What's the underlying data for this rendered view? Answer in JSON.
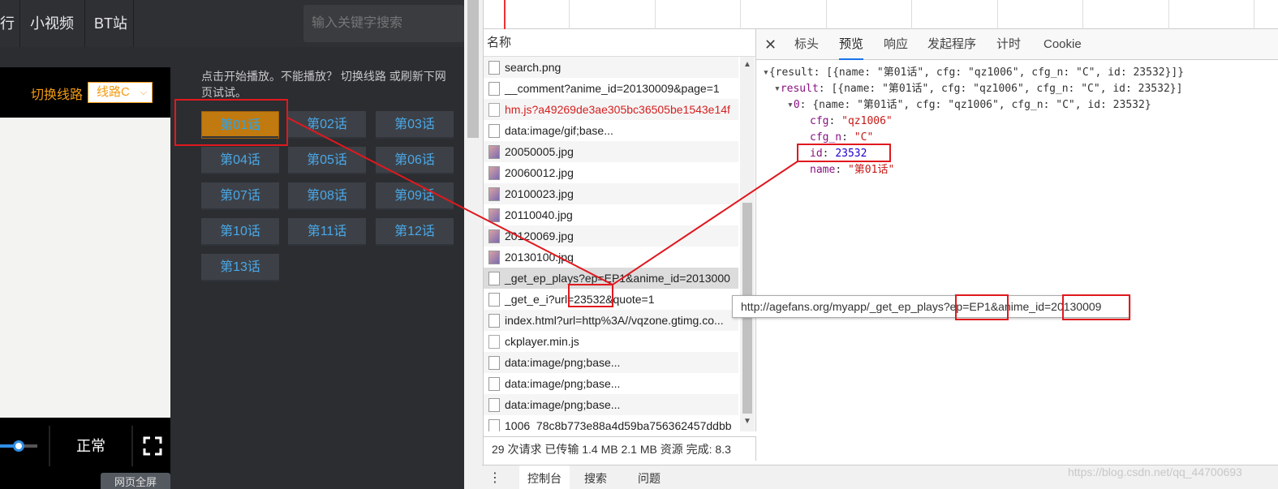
{
  "site": {
    "nav": [
      {
        "label": "行"
      },
      {
        "label": "小视频"
      },
      {
        "label": "BT站"
      }
    ],
    "search_placeholder": "输入关键字搜索",
    "player": {
      "switch_label": "切换线路",
      "line_value": "线路C",
      "speed_label": "正常",
      "volume_level": 0.5
    },
    "hint_text": "点击开始播放。不能播放？ 切换线路 或刷新下网页试试。",
    "episodes": [
      "第01话",
      "第02话",
      "第03话",
      "第04话",
      "第05话",
      "第06话",
      "第07话",
      "第08话",
      "第09话",
      "第10话",
      "第11话",
      "第12话",
      "第13话"
    ],
    "active_episode": "第01话",
    "page_list_btn": "网页全屏"
  },
  "devtools": {
    "name_header": "名称",
    "requests": [
      {
        "name": "search.png",
        "type": "img"
      },
      {
        "name": "__comment?anime_id=20130009&page=1",
        "type": "doc"
      },
      {
        "name": "hm.js?a49269de3ae305bc36505be1543e14f",
        "type": "js",
        "error": true
      },
      {
        "name": "data:image/gif;base...",
        "type": "doc"
      },
      {
        "name": "20050005.jpg",
        "type": "img"
      },
      {
        "name": "20060012.jpg",
        "type": "img"
      },
      {
        "name": "20100023.jpg",
        "type": "img"
      },
      {
        "name": "20110040.jpg",
        "type": "img"
      },
      {
        "name": "20120069.jpg",
        "type": "img"
      },
      {
        "name": "20130100.jpg",
        "type": "img"
      },
      {
        "name": "_get_ep_plays?ep=EP1&anime_id=2013000",
        "type": "doc",
        "selected": true
      },
      {
        "name": "_get_e_i?url=23532&quote=1",
        "type": "doc"
      },
      {
        "name": "index.html?url=http%3A//vqzone.gtimg.co...",
        "type": "doc"
      },
      {
        "name": "ckplayer.min.js",
        "type": "js"
      },
      {
        "name": "data:image/png;base...",
        "type": "img"
      },
      {
        "name": "data:image/png;base...",
        "type": "img"
      },
      {
        "name": "data:image/png;base...",
        "type": "doc"
      },
      {
        "name": "1006_78c8b773e88a4d59ba756362457ddbb",
        "type": "doc"
      }
    ],
    "status_text": "29 次请求  已传输 1.4 MB  2.1 MB 资源  完成: 8.3",
    "tabs": [
      "标头",
      "预览",
      "响应",
      "发起程序",
      "计时",
      "Cookie"
    ],
    "active_tab": "预览",
    "preview": {
      "line1": "{result: [{name: \"第01话\", cfg: \"qz1006\", cfg_n: \"C\", id: 23532}]}",
      "line2_key": "result",
      "line2_val": "[{name: \"第01话\", cfg: \"qz1006\", cfg_n: \"C\", id: 23532}]",
      "line3_key": "0",
      "line3_val": "{name: \"第01话\", cfg: \"qz1006\", cfg_n: \"C\", id: 23532}",
      "cfg_key": "cfg",
      "cfg_val": "\"qz1006\"",
      "cfgn_key": "cfg_n",
      "cfgn_val": "\"C\"",
      "id_key": "id",
      "id_val": "23532",
      "name_key": "name",
      "name_val": "\"第01话\""
    },
    "tooltip": "http://agefans.org/myapp/_get_ep_plays?ep=EP1&anime_id=20130009",
    "console_tabs": [
      "控制台",
      "搜索",
      "问题"
    ],
    "console_more": "⋮",
    "watermark": "https://blog.csdn.net/qq_44700693"
  },
  "colors": {
    "annotation": "#e0191e",
    "accent_orange": "#f39c12",
    "link_blue": "#4aa8e8"
  }
}
